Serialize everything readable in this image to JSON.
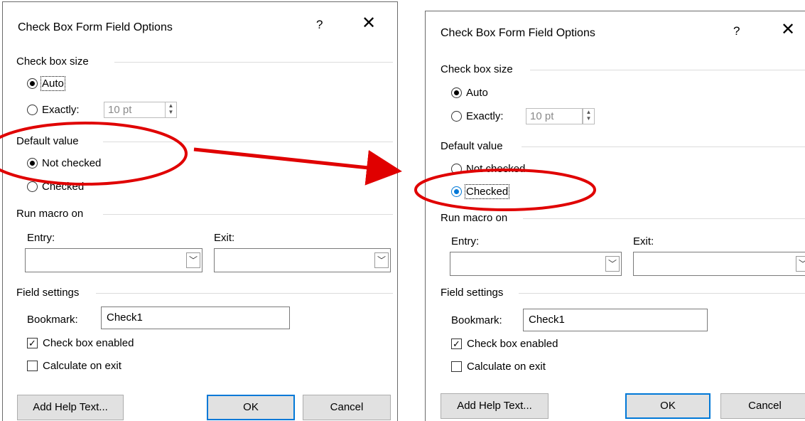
{
  "left_dialog": {
    "title": "Check Box Form Field Options",
    "help": "?",
    "close": "✕",
    "check_box_size": {
      "heading": "Check box size",
      "auto": "Auto",
      "exactly": "Exactly:",
      "exactly_value": "10 pt",
      "selected": "Auto"
    },
    "default_value": {
      "heading": "Default value",
      "not_checked": "Not checked",
      "checked": "Checked",
      "selected": "Not checked"
    },
    "run_macro_on": {
      "heading": "Run macro on",
      "entry_label": "Entry:",
      "exit_label": "Exit:"
    },
    "field_settings": {
      "heading": "Field settings",
      "bookmark_label": "Bookmark:",
      "bookmark_value": "Check1",
      "check_box_enabled": "Check box enabled",
      "check_box_enabled_checked": true,
      "calculate_on_exit": "Calculate on exit",
      "calculate_on_exit_checked": false
    },
    "buttons": {
      "add_help_text": "Add Help Text...",
      "ok": "OK",
      "cancel": "Cancel"
    }
  },
  "right_dialog": {
    "title": "Check Box Form Field Options",
    "help": "?",
    "close": "✕",
    "check_box_size": {
      "heading": "Check box size",
      "auto": "Auto",
      "exactly": "Exactly:",
      "exactly_value": "10 pt",
      "selected": "Auto"
    },
    "default_value": {
      "heading": "Default value",
      "not_checked": "Not checked",
      "checked": "Checked",
      "selected": "Checked"
    },
    "run_macro_on": {
      "heading": "Run macro on",
      "entry_label": "Entry:",
      "exit_label": "Exit:"
    },
    "field_settings": {
      "heading": "Field settings",
      "bookmark_label": "Bookmark:",
      "bookmark_value": "Check1",
      "check_box_enabled": "Check box enabled",
      "check_box_enabled_checked": true,
      "calculate_on_exit": "Calculate on exit",
      "calculate_on_exit_checked": false
    },
    "buttons": {
      "add_help_text": "Add Help Text...",
      "ok": "OK",
      "cancel": "Cancel"
    }
  },
  "annotations": {
    "highlight_color": "#e00000",
    "arrow": "left default value to right checked option"
  }
}
